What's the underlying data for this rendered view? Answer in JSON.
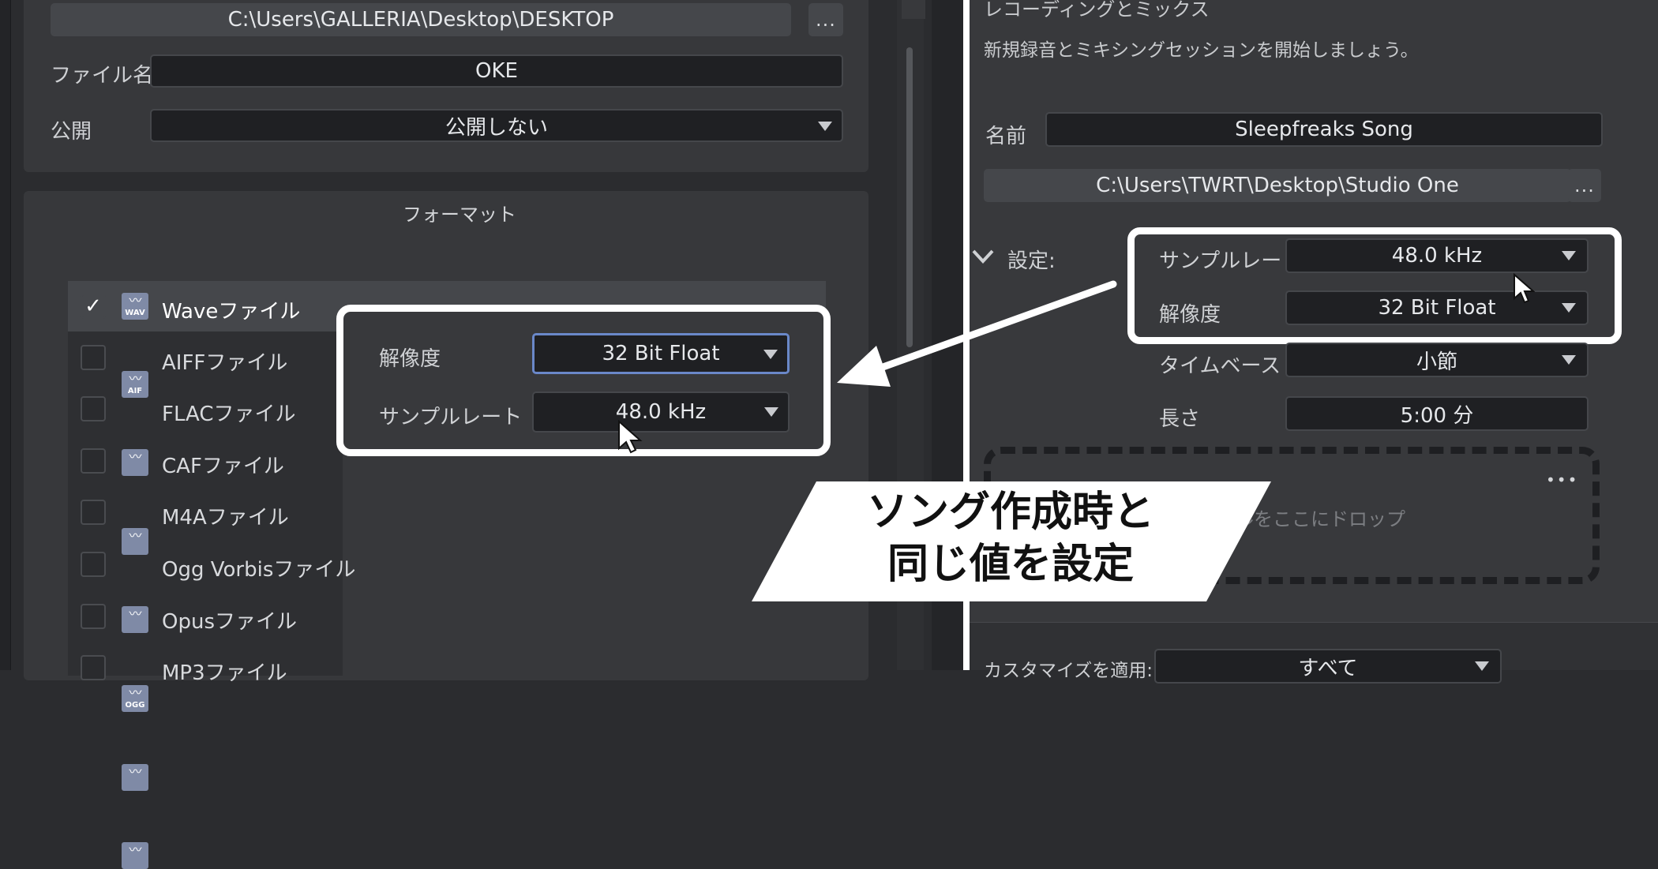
{
  "left_panel": {
    "path_value": "C:\\Users\\GALLERIA\\Desktop\\DESKTOP",
    "browse_label": "...",
    "filename_label": "ファイル名",
    "filename_value": "OKE",
    "publish_label": "公開",
    "publish_value": "公開しない",
    "format_heading": "フォーマット",
    "formats": [
      {
        "label": "Waveファイル",
        "tag": "WAV",
        "checked": "✓"
      },
      {
        "label": "AIFFファイル",
        "tag": "AIF",
        "checked": ""
      },
      {
        "label": "FLACファイル",
        "tag": "",
        "checked": ""
      },
      {
        "label": "CAFファイル",
        "tag": "",
        "checked": ""
      },
      {
        "label": "M4Aファイル",
        "tag": "",
        "checked": ""
      },
      {
        "label": "Ogg Vorbisファイル",
        "tag": "OGG",
        "checked": ""
      },
      {
        "label": "Opusファイル",
        "tag": "",
        "checked": ""
      },
      {
        "label": "MP3ファイル",
        "tag": "",
        "checked": ""
      }
    ]
  },
  "format_callout": {
    "resolution_label": "解像度",
    "resolution_value": "32 Bit Float",
    "samplerate_label": "サンプルレート",
    "samplerate_value": "48.0 kHz"
  },
  "right_panel": {
    "title": "レコーディングとミックス",
    "description": "新規録音とミキシングセッションを開始しましょう。",
    "name_label": "名前",
    "name_value": "Sleepfreaks Song",
    "path_value": "C:\\Users\\TWRT\\Desktop\\Studio One",
    "browse_label": "...",
    "settings_label": "設定:",
    "samplerate_label": "サンプルレート",
    "samplerate_value": "48.0 kHz",
    "resolution_label": "解像度",
    "resolution_value": "32 Bit Float",
    "timebase_label": "タイムベース",
    "timebase_value": "小節",
    "length_label": "長さ",
    "length_value": "5:00 分",
    "dropzone_text": "ルをここにドロップ",
    "dropzone_menu": "•••",
    "customize_label": "カスタマイズを適用:",
    "customize_value": "すべて"
  },
  "banner": {
    "line1": "ソング作成時と",
    "line2": "同じ値を設定"
  },
  "colors": {
    "background": "#2b2c2f",
    "panel": "#38393c",
    "field": "#1f2023",
    "highlight_border": "#ffffff",
    "focus_border": "#6a88c9",
    "icon": "#7f8aa6"
  }
}
